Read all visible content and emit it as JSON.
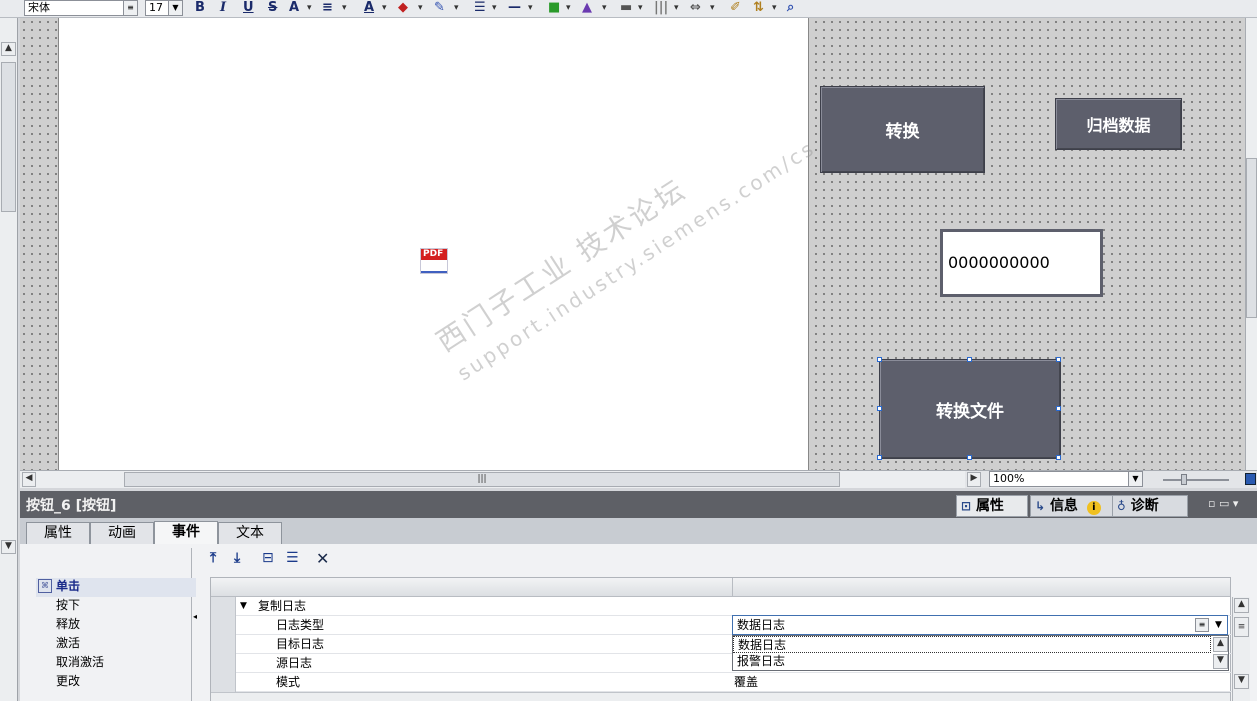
{
  "toolbar": {
    "font_name": "宋体",
    "font_size": "17",
    "bold": "B",
    "italic": "I",
    "underline": "U",
    "strike": "S",
    "font_up": "A"
  },
  "screen": {
    "pdf_label": "PDF",
    "btn_convert": "转换",
    "btn_archive": "归档数据",
    "io_value": "0000000000",
    "btn_convert_file": "转换文件",
    "watermark_cn": "西门子工业  技术论坛",
    "watermark_url": "support.industry.siemens.com/cs"
  },
  "zoom": {
    "value": "100%"
  },
  "inspector": {
    "title": "按钮_6 [按钮]",
    "right_tabs": [
      "属性",
      "信息",
      "诊断"
    ],
    "tabs": [
      "属性",
      "动画",
      "事件",
      "文本"
    ],
    "events": [
      "单击",
      "按下",
      "释放",
      "激活",
      "取消激活",
      "更改"
    ],
    "function_group": "复制日志",
    "params": [
      {
        "name": "日志类型",
        "value": "数据日志"
      },
      {
        "name": "目标日志",
        "value": ""
      },
      {
        "name": "源日志",
        "value": ""
      },
      {
        "name": "模式",
        "value": "覆盖"
      }
    ],
    "dropdown_options": [
      "数据日志",
      "报警日志"
    ]
  }
}
